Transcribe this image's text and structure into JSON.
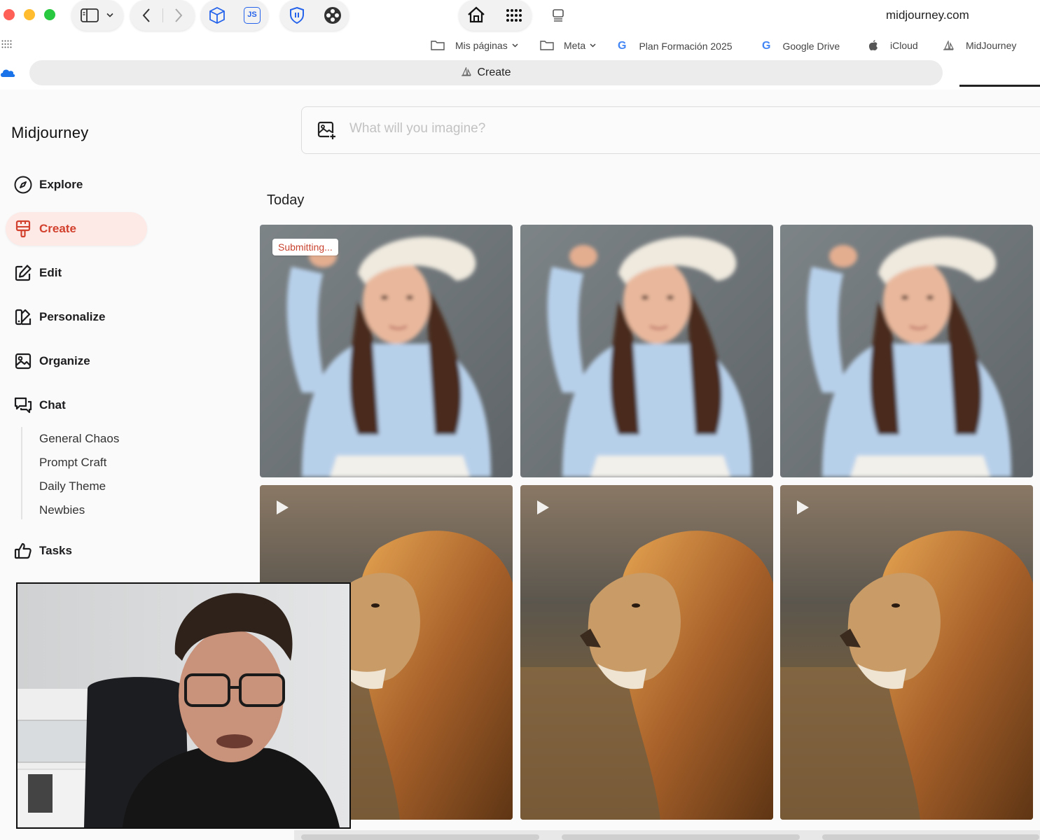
{
  "browser": {
    "url": "midjourney.com",
    "tab_title": "Create",
    "bookmarks": [
      {
        "label": "Mis páginas",
        "icon": "folder-icon",
        "dropdown": true
      },
      {
        "label": "Meta",
        "icon": "folder-icon",
        "dropdown": true
      },
      {
        "label": "Plan Formación 2025",
        "icon": "google-icon",
        "dropdown": false
      },
      {
        "label": "Google Drive",
        "icon": "google-icon",
        "dropdown": false
      },
      {
        "label": "iCloud",
        "icon": "apple-icon",
        "dropdown": false
      },
      {
        "label": "MidJourney",
        "icon": "midjourney-icon",
        "dropdown": false
      }
    ]
  },
  "sidebar": {
    "brand": "Midjourney",
    "items": [
      {
        "label": "Explore",
        "icon": "compass-icon",
        "active": false
      },
      {
        "label": "Create",
        "icon": "brush-icon",
        "active": true
      },
      {
        "label": "Edit",
        "icon": "edit-icon",
        "active": false
      },
      {
        "label": "Personalize",
        "icon": "personalize-icon",
        "active": false
      },
      {
        "label": "Organize",
        "icon": "gallery-icon",
        "active": false
      },
      {
        "label": "Chat",
        "icon": "chat-icon",
        "active": false
      },
      {
        "label": "Tasks",
        "icon": "thumbs-up-icon",
        "active": false
      }
    ],
    "chat_channels": [
      "General Chaos",
      "Prompt Craft",
      "Daily Theme",
      "Newbies"
    ]
  },
  "main": {
    "prompt_placeholder": "What will you imagine?",
    "section_title": "Today",
    "status_badge": "Submitting...",
    "accent_color": "#d2412d"
  }
}
